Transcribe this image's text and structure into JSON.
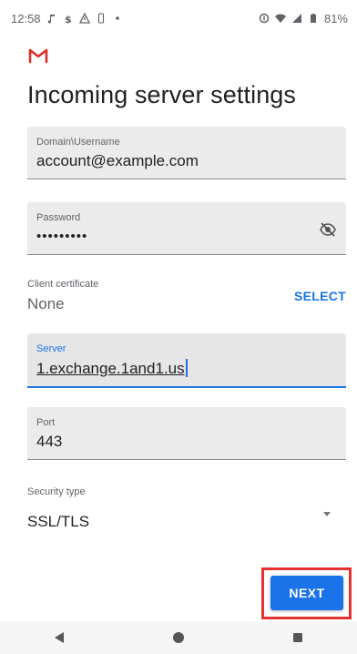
{
  "status_bar": {
    "time": "12:58",
    "battery": "81%",
    "left_icons": [
      "music-icon",
      "money-icon",
      "warning-icon",
      "phone-icon",
      "dot-icon"
    ],
    "right_icons": [
      "data-saver-icon",
      "wifi-icon",
      "signal-icon",
      "battery-icon"
    ]
  },
  "app": {
    "logo": "gmail-logo",
    "brand_color": "#d93025",
    "accent_color": "#1a73e8",
    "title": "Incoming server settings"
  },
  "form": {
    "username": {
      "label": "Domain\\Username",
      "value": "account@example.com"
    },
    "password": {
      "label": "Password",
      "value": "•••••••••",
      "toggle_icon": "visibility-off-icon"
    },
    "certificate": {
      "label": "Client certificate",
      "value": "None",
      "action": "SELECT"
    },
    "server": {
      "label": "Server",
      "value": "1.exchange.1and1.us"
    },
    "port": {
      "label": "Port",
      "value": "443"
    },
    "security": {
      "label": "Security type",
      "value": "SSL/TLS",
      "icon": "dropdown-arrow-icon"
    }
  },
  "actions": {
    "next_label": "NEXT",
    "highlight_color": "#e5312f"
  },
  "nav": {
    "icons": [
      "back-icon",
      "home-icon",
      "recents-icon"
    ]
  }
}
